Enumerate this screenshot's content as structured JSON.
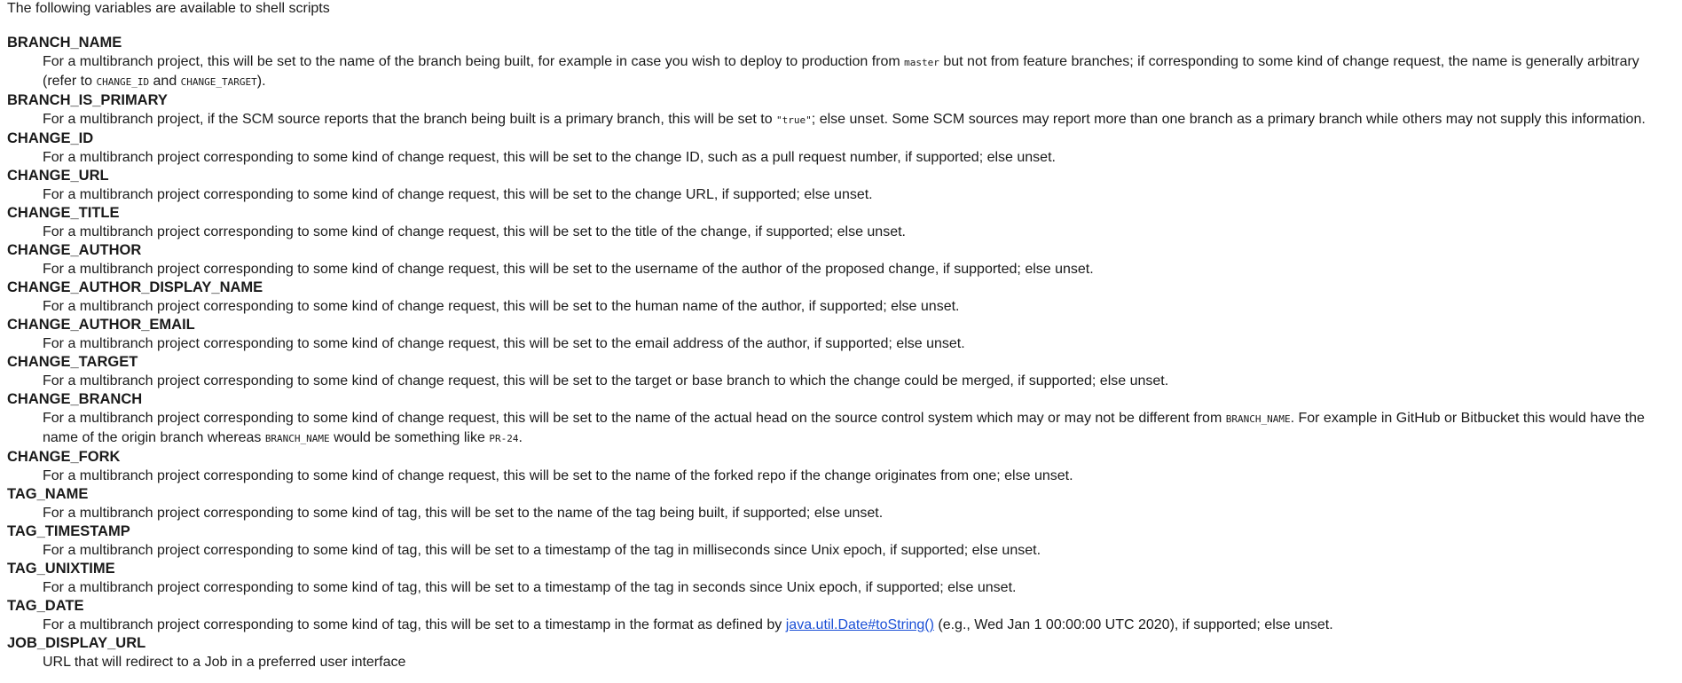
{
  "intro": "The following variables are available to shell scripts",
  "vars": [
    {
      "name": "BRANCH_NAME",
      "desc": {
        "t1": "For a multibranch project, this will be set to the name of the branch being built, for example in case you wish to deploy to production from ",
        "c1": "master",
        "t2": " but not from feature branches; if corresponding to some kind of change request, the name is generally arbitrary (refer to ",
        "c2": "CHANGE_ID",
        "t3": " and ",
        "c3": "CHANGE_TARGET",
        "t4": ")."
      }
    },
    {
      "name": "BRANCH_IS_PRIMARY",
      "desc": {
        "t1": "For a multibranch project, if the SCM source reports that the branch being built is a primary branch, this will be set to ",
        "c1": "\"true\"",
        "t2": "; else unset. Some SCM sources may report more than one branch as a primary branch while others may not supply this information."
      }
    },
    {
      "name": "CHANGE_ID",
      "desc": "For a multibranch project corresponding to some kind of change request, this will be set to the change ID, such as a pull request number, if supported; else unset."
    },
    {
      "name": "CHANGE_URL",
      "desc": "For a multibranch project corresponding to some kind of change request, this will be set to the change URL, if supported; else unset."
    },
    {
      "name": "CHANGE_TITLE",
      "desc": "For a multibranch project corresponding to some kind of change request, this will be set to the title of the change, if supported; else unset."
    },
    {
      "name": "CHANGE_AUTHOR",
      "desc": "For a multibranch project corresponding to some kind of change request, this will be set to the username of the author of the proposed change, if supported; else unset."
    },
    {
      "name": "CHANGE_AUTHOR_DISPLAY_NAME",
      "desc": "For a multibranch project corresponding to some kind of change request, this will be set to the human name of the author, if supported; else unset."
    },
    {
      "name": "CHANGE_AUTHOR_EMAIL",
      "desc": "For a multibranch project corresponding to some kind of change request, this will be set to the email address of the author, if supported; else unset."
    },
    {
      "name": "CHANGE_TARGET",
      "desc": "For a multibranch project corresponding to some kind of change request, this will be set to the target or base branch to which the change could be merged, if supported; else unset."
    },
    {
      "name": "CHANGE_BRANCH",
      "desc": {
        "t1": "For a multibranch project corresponding to some kind of change request, this will be set to the name of the actual head on the source control system which may or may not be different from ",
        "c1": "BRANCH_NAME",
        "t2": ". For example in GitHub or Bitbucket this would have the name of the origin branch whereas ",
        "c2": "BRANCH_NAME",
        "t3": " would be something like ",
        "c3": "PR-24",
        "t4": "."
      }
    },
    {
      "name": "CHANGE_FORK",
      "desc": "For a multibranch project corresponding to some kind of change request, this will be set to the name of the forked repo if the change originates from one; else unset."
    },
    {
      "name": "TAG_NAME",
      "desc": "For a multibranch project corresponding to some kind of tag, this will be set to the name of the tag being built, if supported; else unset."
    },
    {
      "name": "TAG_TIMESTAMP",
      "desc": "For a multibranch project corresponding to some kind of tag, this will be set to a timestamp of the tag in milliseconds since Unix epoch, if supported; else unset."
    },
    {
      "name": "TAG_UNIXTIME",
      "desc": "For a multibranch project corresponding to some kind of tag, this will be set to a timestamp of the tag in seconds since Unix epoch, if supported; else unset."
    },
    {
      "name": "TAG_DATE",
      "desc": {
        "t1": "For a multibranch project corresponding to some kind of tag, this will be set to a timestamp in the format as defined by ",
        "link": "java.util.Date#toString()",
        "t2": " (e.g., Wed Jan 1 00:00:00 UTC 2020), if supported; else unset."
      }
    },
    {
      "name": "JOB_DISPLAY_URL",
      "desc": "URL that will redirect to a Job in a preferred user interface"
    }
  ],
  "colors": {
    "text": "#1a1a1a",
    "link": "#1a4fd6",
    "background": "#ffffff"
  }
}
